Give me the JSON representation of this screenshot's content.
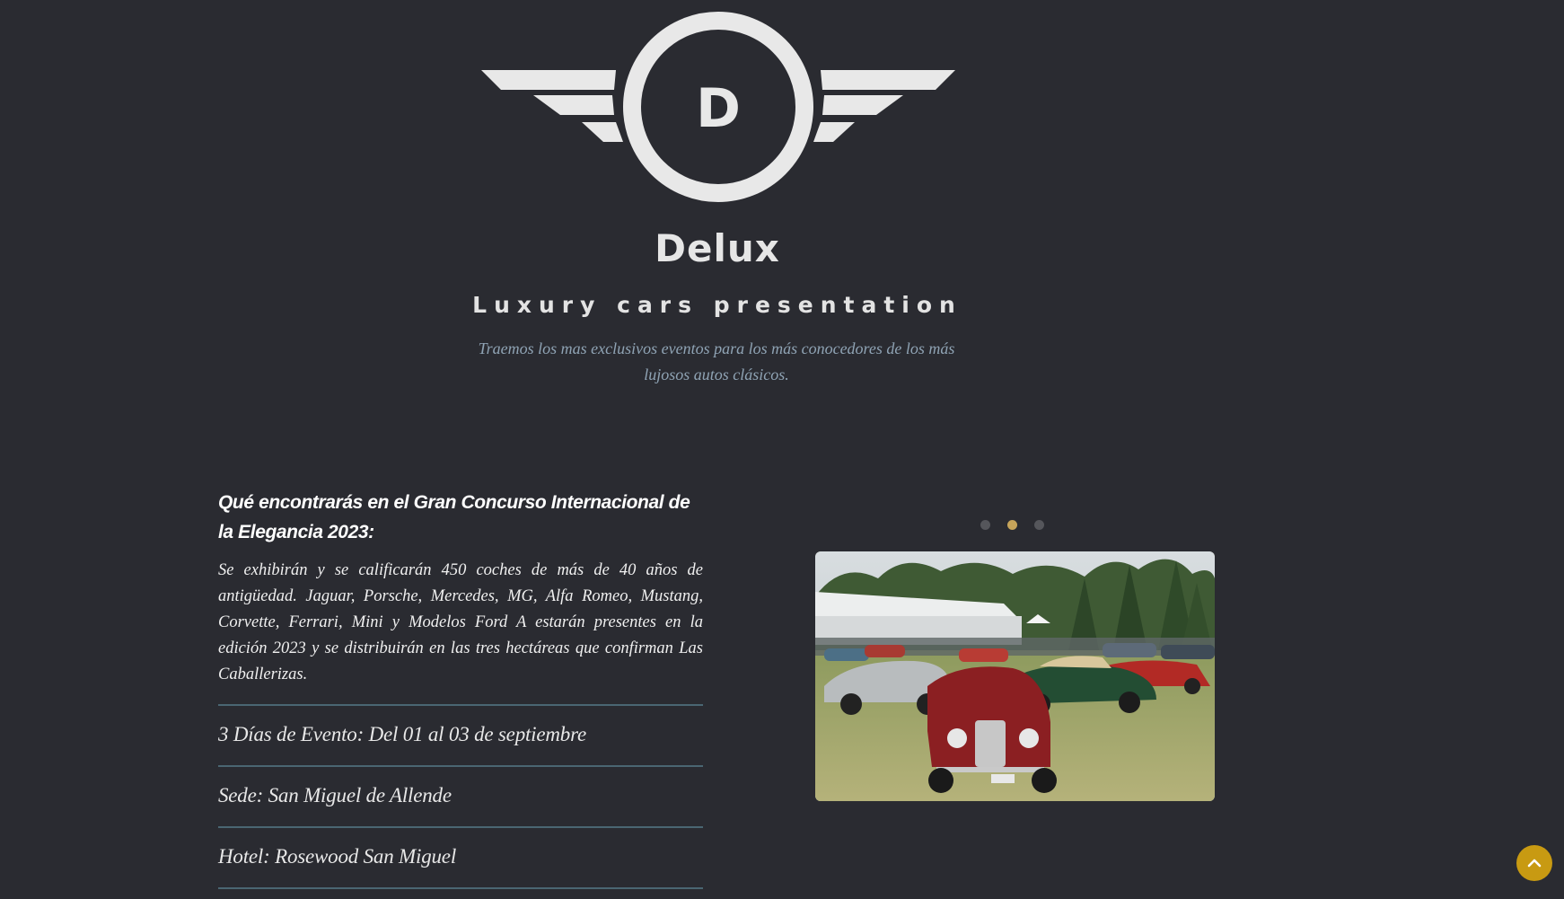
{
  "logo": {
    "letter": "D",
    "brand_name": "Delux",
    "tagline": "Luxury cars presentation"
  },
  "hero": {
    "description": "Traemos los mas exclusivos eventos para los más conocedores de los más lujosos autos clásicos."
  },
  "event": {
    "title": "Qué encontrarás en el Gran Concurso Internacional de la Elegancia 2023:",
    "body": "Se exhibirán y se calificarán 450 coches de más de 40 años de antigüedad. Jaguar, Porsche, Mercedes, MG, Alfa Romeo, Mustang, Corvette, Ferrari, Mini y Modelos Ford A estarán presentes en la edición 2023 y se distribuirán en las tres hectáreas que confirman Las Caballerizas.",
    "details": [
      "3 Días de Evento: Del 01 al 03 de septiembre",
      "Sede: San Miguel de Allende",
      "Hotel: Rosewood San Miguel"
    ]
  },
  "carousel": {
    "slide_count": 3,
    "active_index": 1
  },
  "colors": {
    "background": "#2a2b31",
    "logo": "#e8e8e8",
    "accent_gold": "#c6a45a",
    "back_to_top": "#c89a12",
    "divider": "#4a6672"
  },
  "icons": {
    "back_to_top": "chevron-up-icon"
  }
}
